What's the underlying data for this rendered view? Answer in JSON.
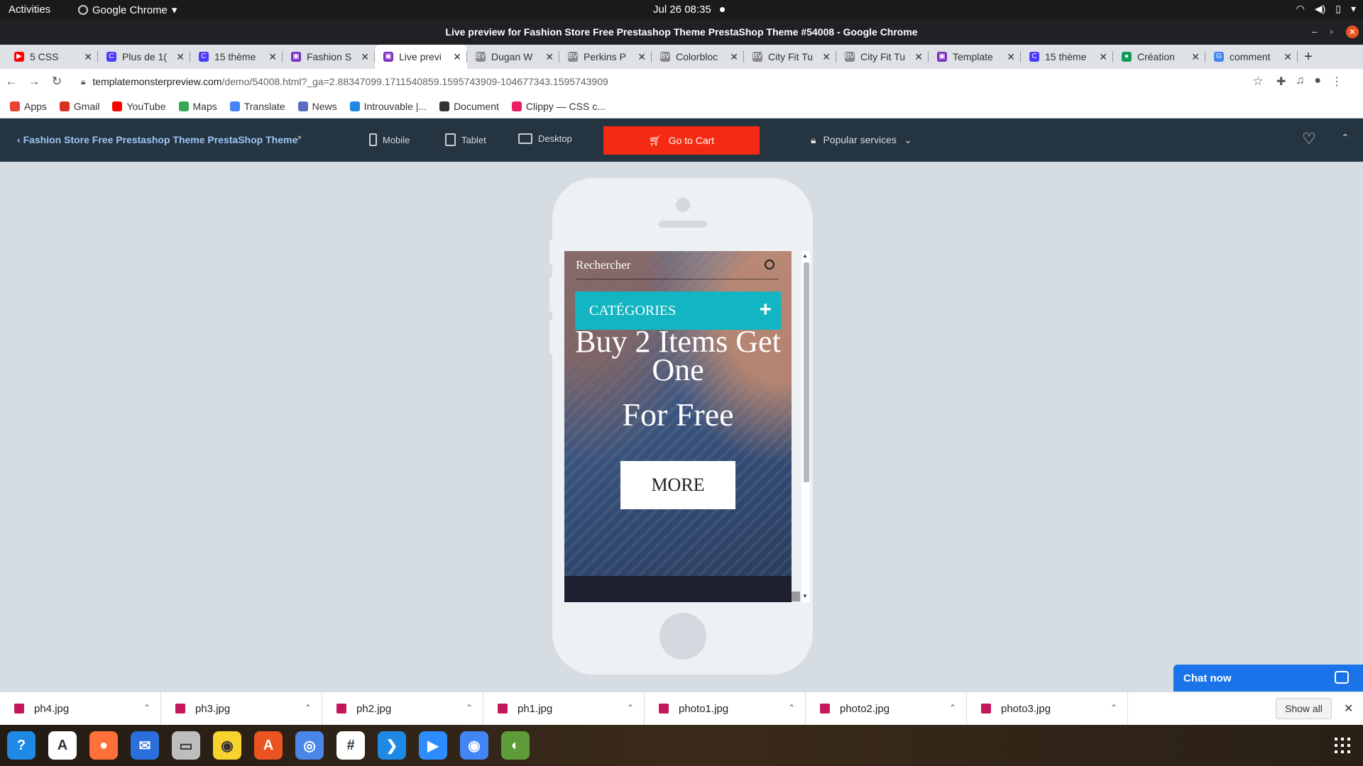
{
  "system": {
    "activities": "Activities",
    "app_name": "Google Chrome",
    "clock": "Jul 26  08:35"
  },
  "window": {
    "title": "Live preview for Fashion Store Free Prestashop Theme PrestaShop Theme #54008 - Google Chrome"
  },
  "tabs": [
    {
      "label": "5 CSS",
      "color": "#ff0000",
      "glyph": "▶"
    },
    {
      "label": "Plus de 1(",
      "color": "#4a3aff",
      "glyph": "C"
    },
    {
      "label": "15 thème",
      "color": "#4a3aff",
      "glyph": "C"
    },
    {
      "label": "Fashion S",
      "color": "#7b2cbf",
      "glyph": "▣"
    },
    {
      "label": "Live previ",
      "color": "#7b2cbf",
      "glyph": "▣"
    },
    {
      "label": "Dugan W",
      "color": "#888888",
      "glyph": "BV"
    },
    {
      "label": "Perkins P",
      "color": "#888888",
      "glyph": "BV"
    },
    {
      "label": "Colorbloc",
      "color": "#888888",
      "glyph": "BV"
    },
    {
      "label": "City Fit Tu",
      "color": "#888888",
      "glyph": "BV"
    },
    {
      "label": "City Fit Tu",
      "color": "#888888",
      "glyph": "BV"
    },
    {
      "label": "Template",
      "color": "#7b2cbf",
      "glyph": "▣"
    },
    {
      "label": "15 thème",
      "color": "#4a3aff",
      "glyph": "C"
    },
    {
      "label": "Création",
      "color": "#0f9d58",
      "glyph": "●"
    },
    {
      "label": "comment",
      "color": "#4285f4",
      "glyph": "G"
    }
  ],
  "omnibox": {
    "host": "templatemonsterpreview.com",
    "path": "/demo/54008.html?_ga=2.88347099.1711540859.1595743909-104677343.1595743909"
  },
  "bookmarks": [
    {
      "label": "Apps",
      "color": "#ea4335"
    },
    {
      "label": "Gmail",
      "color": "#d93025"
    },
    {
      "label": "YouTube",
      "color": "#ff0000"
    },
    {
      "label": "Maps",
      "color": "#34a853"
    },
    {
      "label": "Translate",
      "color": "#4285f4"
    },
    {
      "label": "News",
      "color": "#5c6bc0"
    },
    {
      "label": "Introuvable |...",
      "color": "#1e88e5"
    },
    {
      "label": "Document",
      "color": "#333333"
    },
    {
      "label": "Clippy — CSS c...",
      "color": "#e91e63"
    }
  ],
  "preview_bar": {
    "back_link": "Fashion Store Free Prestashop Theme PrestaShop Theme",
    "mobile": "Mobile",
    "tablet": "Tablet",
    "desktop": "Desktop",
    "cart": "Go to Cart",
    "popular": "Popular services"
  },
  "site": {
    "search_placeholder": "Rechercher",
    "categories": "CATÉGORIES",
    "plus": "+",
    "headline": "Buy 2 Items Get One",
    "headline2": "For Free",
    "more": "MORE"
  },
  "chat": {
    "label": "Chat now"
  },
  "downloads": [
    "ph4.jpg",
    "ph3.jpg",
    "ph2.jpg",
    "ph1.jpg",
    "photo1.jpg",
    "photo2.jpg",
    "photo3.jpg"
  ],
  "show_all": "Show all",
  "dock": [
    {
      "name": "help-app",
      "color": "#1e88e5",
      "glyph": "?"
    },
    {
      "name": "translate-app",
      "color": "#ffffff",
      "glyph": "A"
    },
    {
      "name": "firefox-app",
      "color": "#ff7139",
      "glyph": "●"
    },
    {
      "name": "thunderbird-app",
      "color": "#2a6fdb",
      "glyph": "✉"
    },
    {
      "name": "files-app",
      "color": "#bdbdbd",
      "glyph": "▭"
    },
    {
      "name": "rhythmbox-app",
      "color": "#f6d32d",
      "glyph": "◉"
    },
    {
      "name": "software-app",
      "color": "#e95420",
      "glyph": "A"
    },
    {
      "name": "chromium-app",
      "color": "#4a86e8",
      "glyph": "◎"
    },
    {
      "name": "slack-app",
      "color": "#ffffff",
      "glyph": "#"
    },
    {
      "name": "vscode-app",
      "color": "#1e88e5",
      "glyph": "❯"
    },
    {
      "name": "zoom-app",
      "color": "#2d8cff",
      "glyph": "▶"
    },
    {
      "name": "chrome-app",
      "color": "#4285f4",
      "glyph": "◉"
    },
    {
      "name": "web-app",
      "color": "#5e9c3a",
      "glyph": "◐"
    }
  ]
}
